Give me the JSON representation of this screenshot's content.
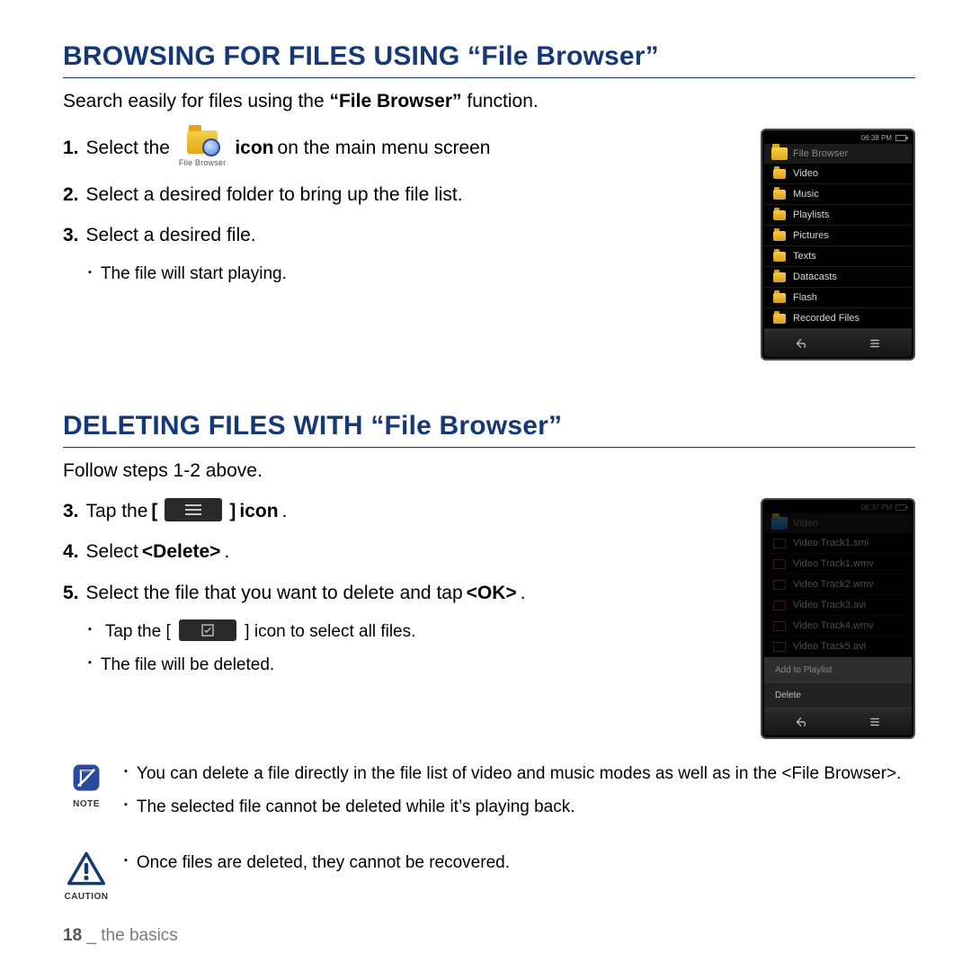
{
  "section1": {
    "title": "BROWSING FOR FILES USING “File Browser”",
    "intro_pre": "Search easily for files using the ",
    "intro_bold": "“File Browser”",
    "intro_post": " function.",
    "step1_pre": "Select the",
    "step1_iconlabel": "File Browser",
    "step1_bold": "icon",
    "step1_post": " on the main menu screen",
    "step2": "Select a desired folder to bring up the file list.",
    "step3": "Select a desired file.",
    "step3_sub": "The file will start playing."
  },
  "device1": {
    "time": "06:38 PM",
    "header": "File Browser",
    "folders": [
      "Video",
      "Music",
      "Playlists",
      "Pictures",
      "Texts",
      "Datacasts",
      "Flash",
      "Recorded Files"
    ]
  },
  "section2": {
    "title": "DELETING FILES WITH “File Browser”",
    "intro": "Follow steps 1-2 above.",
    "step3_pre": "Tap the ",
    "step3_post": "icon",
    "step4_pre": "Select ",
    "step4_bold": "<Delete>",
    "step5_pre": "Select the file that you want to delete and tap ",
    "step5_bold": "<OK>",
    "step5_sub1_pre": "Tap the [",
    "step5_sub1_post": "] icon to select all files.",
    "step5_sub2": "The file will be deleted."
  },
  "device2": {
    "time": "06:37 PM",
    "header": "Video",
    "files": [
      "Video Track1.smi",
      "Video Track1.wmv",
      "Video Track2.wmv",
      "Video Track3.avi",
      "Video Track4.wmv",
      "Video Track5.avi"
    ],
    "menu": [
      "Add to Playlist",
      "Delete"
    ]
  },
  "note": {
    "label": "NOTE",
    "b1": "You can delete a file directly in the file list of video and music modes as well as in the <File Browser>.",
    "b2": "The selected file cannot be deleted while it’s playing back."
  },
  "caution": {
    "label": "CAUTION",
    "b1": "Once files are deleted, they cannot be recovered."
  },
  "footer": {
    "page": "18",
    "sep": " _ ",
    "chapter": "the basics"
  }
}
